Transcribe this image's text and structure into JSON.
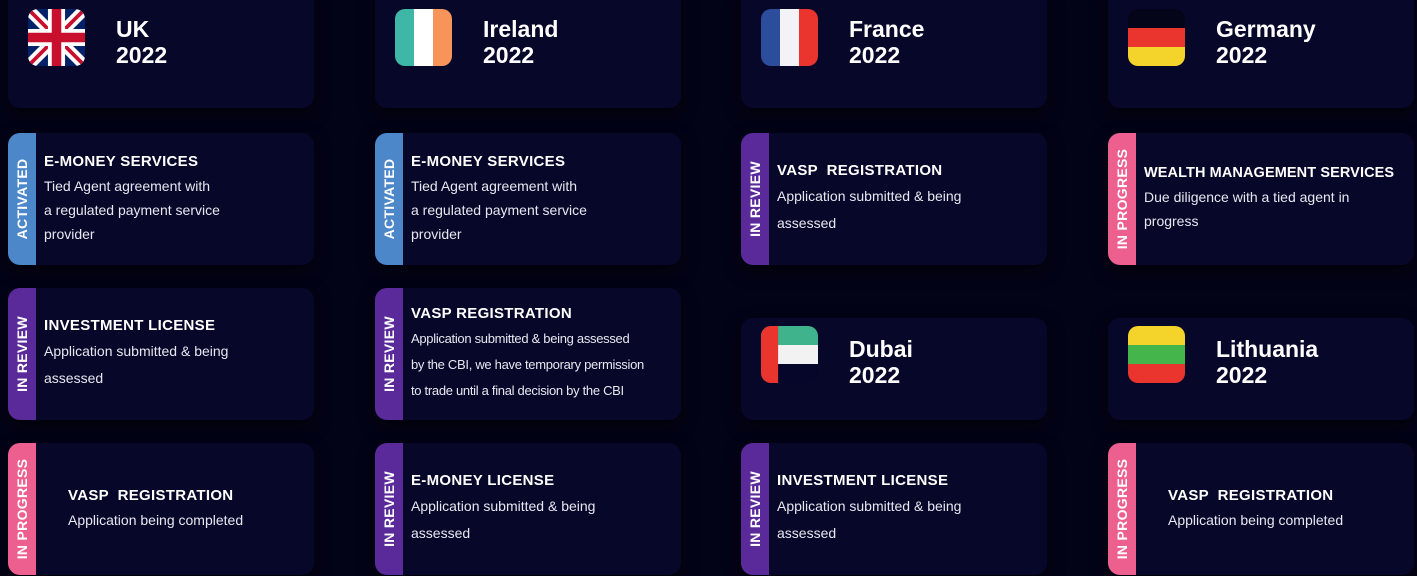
{
  "countries": {
    "uk": {
      "name": "UK",
      "year": "2022"
    },
    "ireland": {
      "name": "Ireland",
      "year": "2022"
    },
    "france": {
      "name": "France",
      "year": "2022"
    },
    "germany": {
      "name": "Germany",
      "year": "2022"
    },
    "dubai": {
      "name": "Dubai",
      "year": "2022"
    },
    "lithuania": {
      "name": "Lithuania",
      "year": "2022"
    }
  },
  "status_labels": {
    "activated": "ACTIVATED",
    "in_review": "IN REVIEW",
    "in_progress": "IN PROGRESS"
  },
  "status_colors": {
    "activated": "#4c87c9",
    "in_review": "#5b2a9a",
    "in_progress": "#ec5f8f"
  },
  "uk_cards": [
    {
      "status": "ACTIVATED",
      "title": "E-MONEY SERVICES",
      "lines": [
        "Tied Agent agreement with",
        "a regulated payment service",
        "provider"
      ]
    },
    {
      "status": "IN REVIEW",
      "title": "INVESTMENT LICENSE",
      "lines": [
        "Application submitted & being",
        "assessed"
      ]
    },
    {
      "status": "IN PROGRESS",
      "title": "VASP  REGISTRATION",
      "lines": [
        "Application being completed"
      ]
    }
  ],
  "ireland_cards": [
    {
      "status": "ACTIVATED",
      "title": "E-MONEY SERVICES",
      "lines": [
        "Tied Agent agreement with",
        "a regulated payment service",
        "provider"
      ]
    },
    {
      "status": "IN REVIEW",
      "title": "VASP REGISTRATION",
      "lines": [
        "Application submitted & being assessed",
        "by the CBI, we have temporary permission",
        "to trade until a final decision by the CBI"
      ]
    },
    {
      "status": "IN REVIEW",
      "title": "E-MONEY LICENSE",
      "lines": [
        "Application submitted & being",
        "assessed"
      ]
    }
  ],
  "france_cards": [
    {
      "status": "IN REVIEW",
      "title": "VASP  REGISTRATION",
      "lines": [
        "Application submitted & being",
        "assessed"
      ]
    }
  ],
  "dubai_cards": [
    {
      "status": "IN REVIEW",
      "title": "INVESTMENT LICENSE",
      "lines": [
        "Application submitted & being",
        "assessed"
      ]
    }
  ],
  "germany_cards": [
    {
      "status": "IN PROGRESS",
      "title": "WEALTH MANAGEMENT SERVICES",
      "lines": [
        "Due diligence with a tied agent in",
        "progress"
      ]
    }
  ],
  "lithuania_cards": [
    {
      "status": "IN PROGRESS",
      "title": "VASP  REGISTRATION",
      "lines": [
        "Application being completed"
      ]
    }
  ],
  "flags": [
    "uk-flag-icon",
    "ireland-flag-icon",
    "france-flag-icon",
    "germany-flag-icon",
    "uae-flag-icon",
    "lithuania-flag-icon"
  ]
}
